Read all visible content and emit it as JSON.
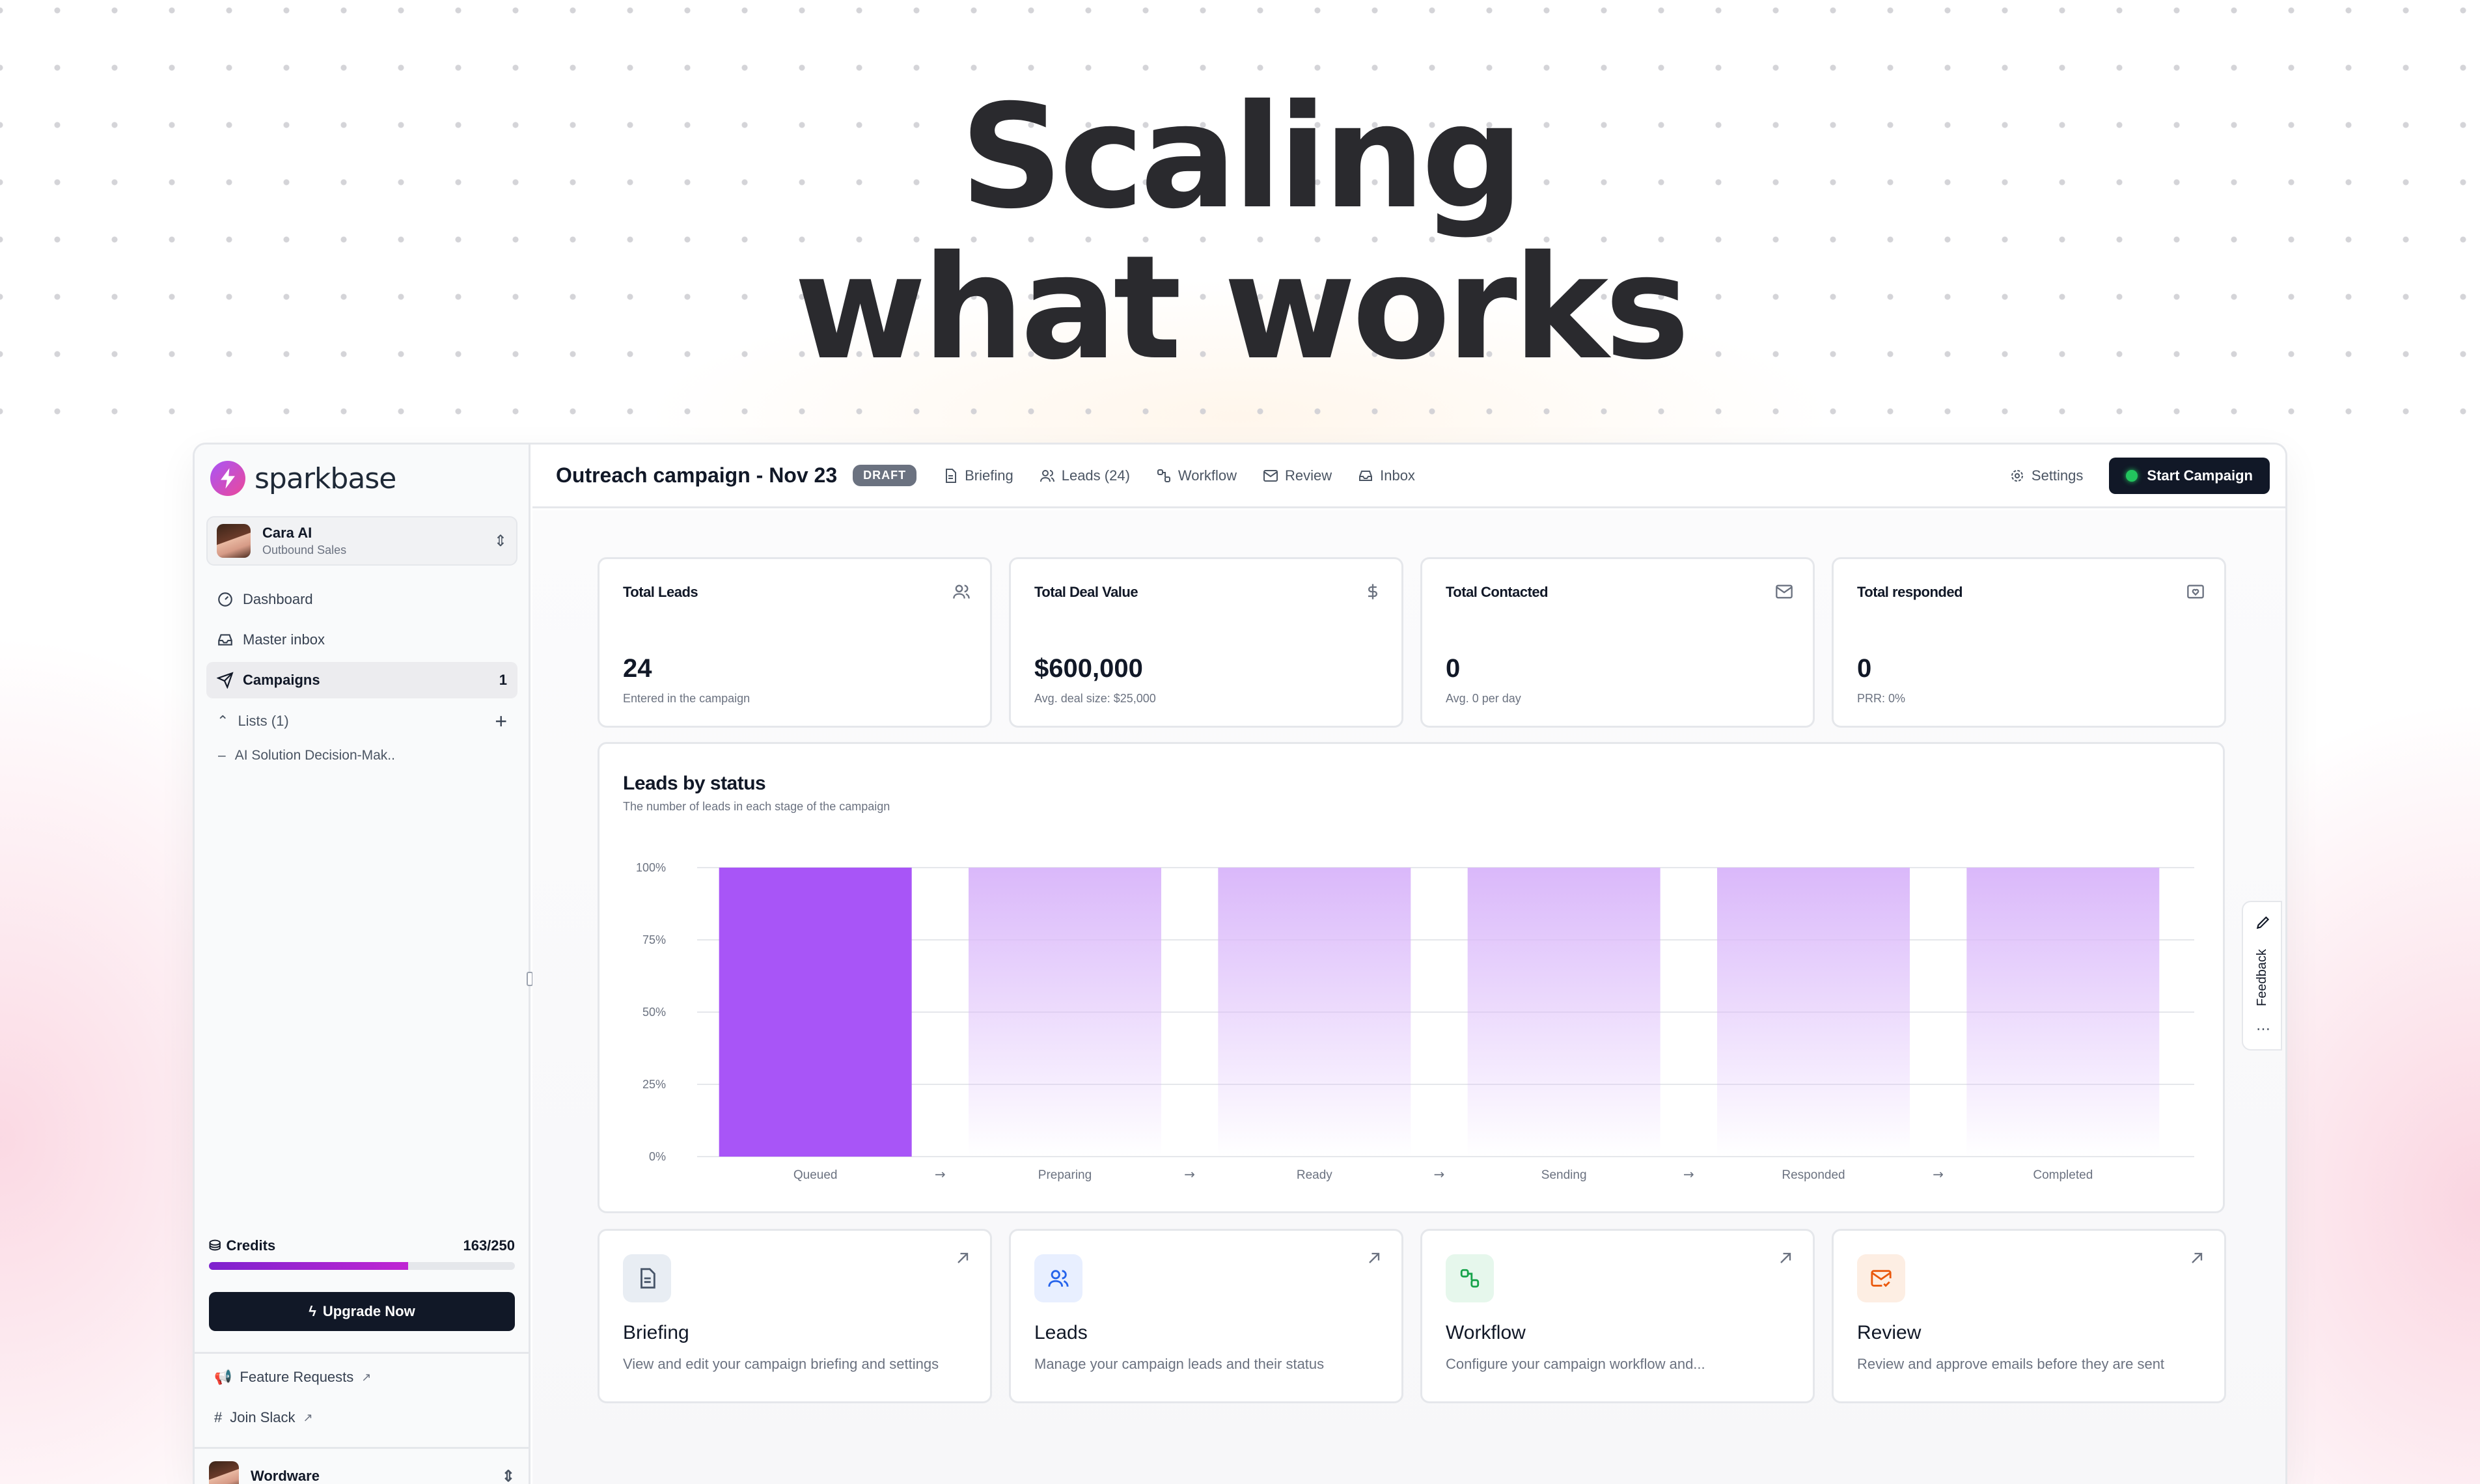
{
  "hero": {
    "line1": "Scaling",
    "line2": "what works"
  },
  "brand": {
    "name": "sparkbase"
  },
  "user": {
    "name": "Cara AI",
    "role": "Outbound Sales"
  },
  "sidebar": {
    "nav": [
      {
        "label": "Dashboard",
        "icon": "gauge-icon"
      },
      {
        "label": "Master inbox",
        "icon": "inbox-icon"
      },
      {
        "label": "Campaigns",
        "icon": "send-icon",
        "count": "1"
      }
    ],
    "lists_label": "Lists (1)",
    "list_item": "AI Solution Decision-Mak..",
    "credits_label": "Credits",
    "credits_value": "163/250",
    "credits_fraction": 0.652,
    "upgrade_label": "Upgrade Now",
    "footer": [
      {
        "label": "Feature Requests",
        "icon": "megaphone-icon"
      },
      {
        "label": "Join Slack",
        "icon": "slack-icon"
      }
    ],
    "org_name": "Wordware"
  },
  "header": {
    "title": "Outreach campaign - Nov 23",
    "badge": "DRAFT",
    "tabs": [
      {
        "label": "Briefing",
        "icon": "document-icon"
      },
      {
        "label": "Leads (24)",
        "icon": "users-icon"
      },
      {
        "label": "Workflow",
        "icon": "workflow-icon"
      },
      {
        "label": "Review",
        "icon": "mail-icon"
      },
      {
        "label": "Inbox",
        "icon": "inbox-icon"
      }
    ],
    "settings_label": "Settings",
    "start_label": "Start Campaign"
  },
  "stats": [
    {
      "label": "Total Leads",
      "value": "24",
      "sub": "Entered in the campaign",
      "icon": "users-icon"
    },
    {
      "label": "Total Deal Value",
      "value": "$600,000",
      "sub": "Avg. deal size: $25,000",
      "icon": "dollar-icon"
    },
    {
      "label": "Total Contacted",
      "value": "0",
      "sub": "Avg. 0 per day",
      "icon": "mail-icon"
    },
    {
      "label": "Total responded",
      "value": "0",
      "sub": "PRR: 0%",
      "icon": "heart-mail-icon"
    }
  ],
  "chart_data": {
    "type": "bar",
    "title": "Leads by status",
    "subtitle": "The number of leads in each stage of the campaign",
    "categories": [
      "Queued",
      "Preparing",
      "Ready",
      "Sending",
      "Responded",
      "Completed"
    ],
    "values": [
      100,
      100,
      100,
      100,
      100,
      100
    ],
    "y_ticks": [
      "0%",
      "25%",
      "50%",
      "75%",
      "100%"
    ],
    "ylim": [
      0,
      100
    ],
    "grid": true,
    "colors": {
      "primary": "#a855f7",
      "faded": "#dab8fa"
    }
  },
  "nav_cards": [
    {
      "title": "Briefing",
      "desc": "View and edit your campaign briefing and settings",
      "icon": "document-icon",
      "color": "#475569",
      "bg": "#e8edf3"
    },
    {
      "title": "Leads",
      "desc": "Manage your campaign leads and their status",
      "icon": "users-icon",
      "color": "#2563eb",
      "bg": "#e8efff"
    },
    {
      "title": "Workflow",
      "desc": "Configure your campaign workflow and...",
      "icon": "workflow-icon",
      "color": "#16a34a",
      "bg": "#e6f7ec"
    },
    {
      "title": "Review",
      "desc": "Review and approve emails before they are sent",
      "icon": "mail-check-icon",
      "color": "#ea580c",
      "bg": "#fdeee3"
    }
  ],
  "feedback_label": "Feedback"
}
